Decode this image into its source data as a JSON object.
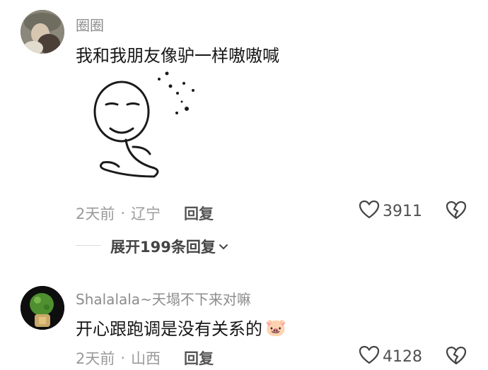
{
  "comments": [
    {
      "username": "圈圈",
      "text": "我和我朋友像驴一样嗷嗷喊",
      "time": "2天前",
      "dot": "·",
      "location": "辽宁",
      "reply_label": "回复",
      "like_count": "3911",
      "sticker": "meme-face-sticker",
      "expand_label": "展开199条回复"
    },
    {
      "username": "Shalalala~天塌不下来对嘛",
      "text": "开心跟跑调是没有关系的",
      "emoji": "🐷",
      "time": "2天前",
      "dot": "·",
      "location": "山西",
      "reply_label": "回复",
      "like_count": "4128"
    }
  ],
  "icons": {
    "like": "heart-icon",
    "dislike": "broken-heart-icon",
    "expand": "chevron-down-icon"
  }
}
